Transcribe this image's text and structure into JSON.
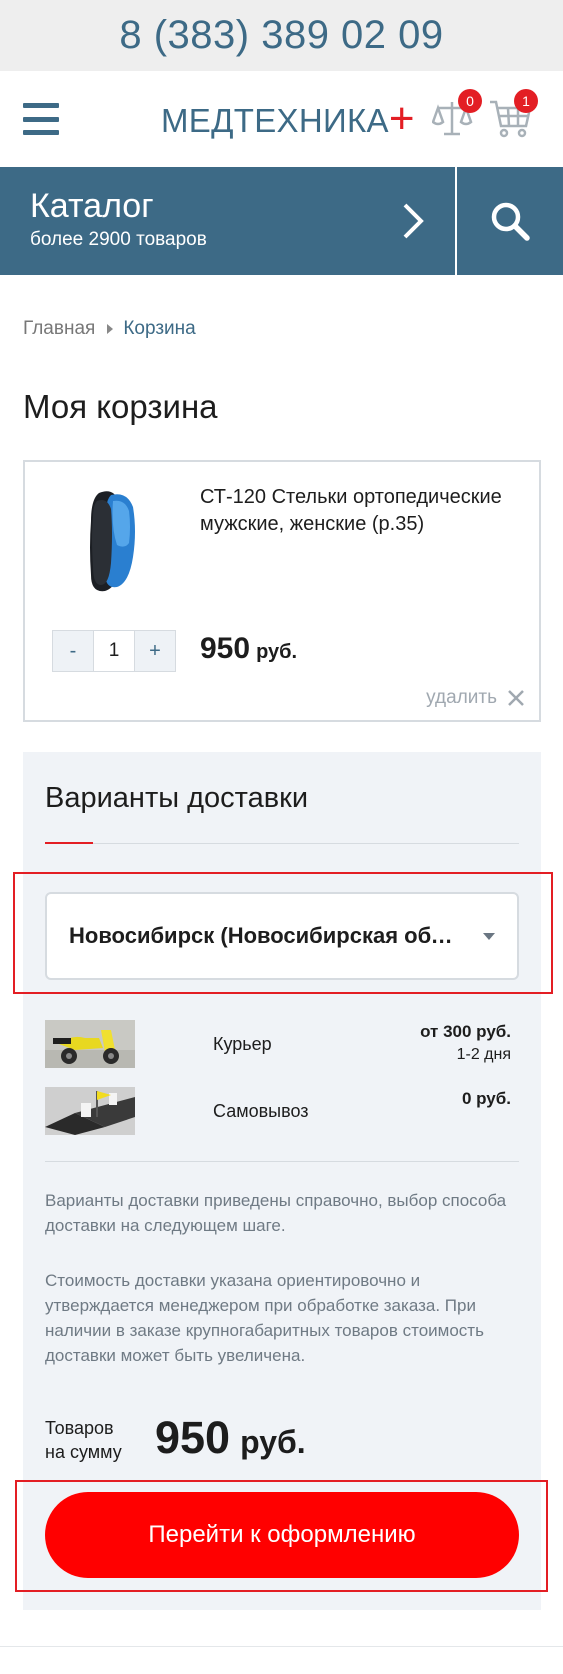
{
  "top_bar": {
    "phone": "8 (383) 389 02 09"
  },
  "header": {
    "logo_text": "МЕДТЕХНИКА",
    "logo_plus": "+",
    "compare_count": "0",
    "cart_count": "1",
    "icons": [
      "menu-icon",
      "compare-scales-icon",
      "cart-icon"
    ]
  },
  "catalog": {
    "title": "Каталог",
    "subtitle": "более 2900 товаров"
  },
  "breadcrumb": {
    "home": "Главная",
    "current": "Корзина"
  },
  "page_title": "Моя корзина",
  "cart_item": {
    "name": "СТ-120 Стельки ортопедические мужские, женские (р.35)",
    "qty_minus": "-",
    "qty_value": "1",
    "qty_plus": "+",
    "price": "950",
    "currency": "руб.",
    "remove_label": "удалить"
  },
  "delivery": {
    "title": "Варианты доставки",
    "city": "Новосибирск (Новосибирская область)",
    "options": [
      {
        "name": "Курьер",
        "price": "от 300 руб.",
        "days": "1-2 дня"
      },
      {
        "name": "Самовывоз",
        "price": "0 руб.",
        "days": ""
      }
    ],
    "note1": "Варианты доставки приведены справочно, выбор способа доставки на следующем шаге.",
    "note2": "Стоимость доставки указана ориентировочно и утверждается менеджером при обработке заказа. При наличии в заказе крупногабаритных товаров стоимость доставки может быть увеличена."
  },
  "total": {
    "label_line1": "Товаров",
    "label_line2": "на сумму",
    "amount": "950",
    "currency": "руб."
  },
  "checkout_label": "Перейти к оформлению",
  "colors": {
    "brand": "#3d6a86",
    "accent": "#e31e24",
    "button": "#ff0000",
    "panel": "#f0f3f7"
  }
}
